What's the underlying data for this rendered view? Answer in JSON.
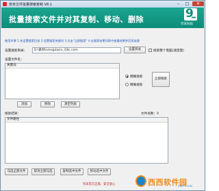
{
  "window": {
    "title": "奈末文件批量搜索复制 V8.1",
    "minimize_glyph": "–",
    "maximize_glyph": "□",
    "close_glyph": "✕"
  },
  "banner": {
    "headline": "批量搜索文件并对其复制、移动、删除",
    "logo_mark": "9",
    "logo_caption": "奈末科技"
  },
  "notice": "使用步骤 1.先设置搜索目录 2.设置搜索关键词 3.点击\"立即搜索\" 4.在搜索结果列表中查看结果并后续处理",
  "search_dir": {
    "label": "设置搜索目录：",
    "value": "D:\\素材\\nmxjplasis_33lc.com",
    "browse_label": "设置目录",
    "subdir_label": "搜索整个电脑(速度慢)"
  },
  "filename": {
    "label": "设置文件名：",
    "column_header": "关键词",
    "add_label": "添加",
    "remove_label": "移除",
    "clear_label": "清空列表"
  },
  "match_mode": {
    "fuzzy_label": "模糊搜索",
    "exact_label": "精确搜索",
    "selected": "fuzzy"
  },
  "search_now_label": "立即搜索",
  "results": {
    "label": "搜索结果：",
    "count_label": "文件总数：0",
    "column_header": "文件路径"
  },
  "actions": {
    "copy_all": "勾选全部文件",
    "copy_checked": "取消全部勾选",
    "copy_selected": "复制选中文件",
    "move_selected": "移动选中文件"
  },
  "footer": "奈末官方正版，安全放心",
  "watermark": {
    "text": "西西软件园",
    "url": "CR173.COM"
  }
}
